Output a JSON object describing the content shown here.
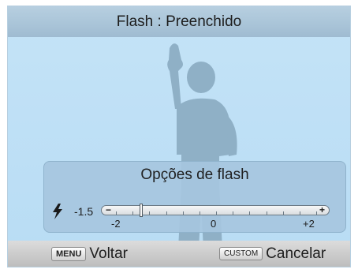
{
  "title": "Flash : Preenchido",
  "panel": {
    "title": "Opções de flash",
    "current_value": "-1.5",
    "level_fraction": 0.125,
    "scale_min": "-2",
    "scale_mid": "0",
    "scale_max": "+2",
    "minus_symbol": "−",
    "plus_symbol": "+"
  },
  "footer": {
    "menu_badge": "MENU",
    "menu_label": "Voltar",
    "custom_badge": "CUSTOM",
    "custom_label": "Cancelar"
  },
  "icons": {
    "flash": "lightning-bolt",
    "subject": "child-silhouette"
  },
  "colors": {
    "background": "#b8dcf4",
    "title_bar": "#a9c4d8",
    "panel": "#a6c6de",
    "footer": "#cdcdcd"
  }
}
